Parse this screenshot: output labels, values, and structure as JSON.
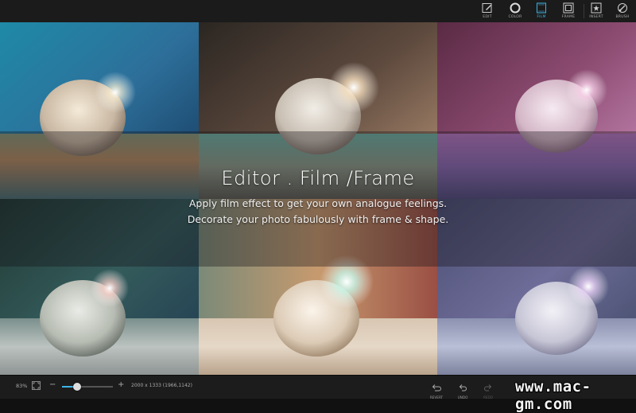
{
  "toolbar": {
    "items": [
      {
        "label": "EDIT",
        "icon": "edit-icon"
      },
      {
        "label": "COLOR",
        "icon": "color-circle-icon"
      },
      {
        "label": "FILM",
        "icon": "film-icon",
        "active": true
      },
      {
        "label": "FRAME",
        "icon": "frame-icon"
      },
      {
        "label": "INSERT",
        "icon": "insert-star-icon"
      },
      {
        "label": "BRUSH",
        "icon": "brush-icon"
      }
    ],
    "active_color": "#3fb4e6"
  },
  "overlay": {
    "headline": "Editor . Film /Frame",
    "line1": "Apply film effect to get your own analogue feelings.",
    "line2": "Decorate your photo fabulously with frame & shape."
  },
  "bottombar": {
    "zoom": "83%",
    "minus": "−",
    "plus": "+",
    "zoom_fraction": 0.3,
    "dimensions": "2000 x 1333  (1966,1142)",
    "tools": [
      {
        "label": "REVERT",
        "icon": "revert-icon"
      },
      {
        "label": "UNDO",
        "icon": "undo-icon"
      },
      {
        "label": "REDO",
        "icon": "redo-icon"
      }
    ],
    "watermark": "www.mac-gm.com"
  },
  "photos": {
    "effects": [
      "teal-blue",
      "warm-sepia",
      "magenta-violet",
      "dark-teal",
      "faded-warm",
      "cool-lavender"
    ]
  }
}
